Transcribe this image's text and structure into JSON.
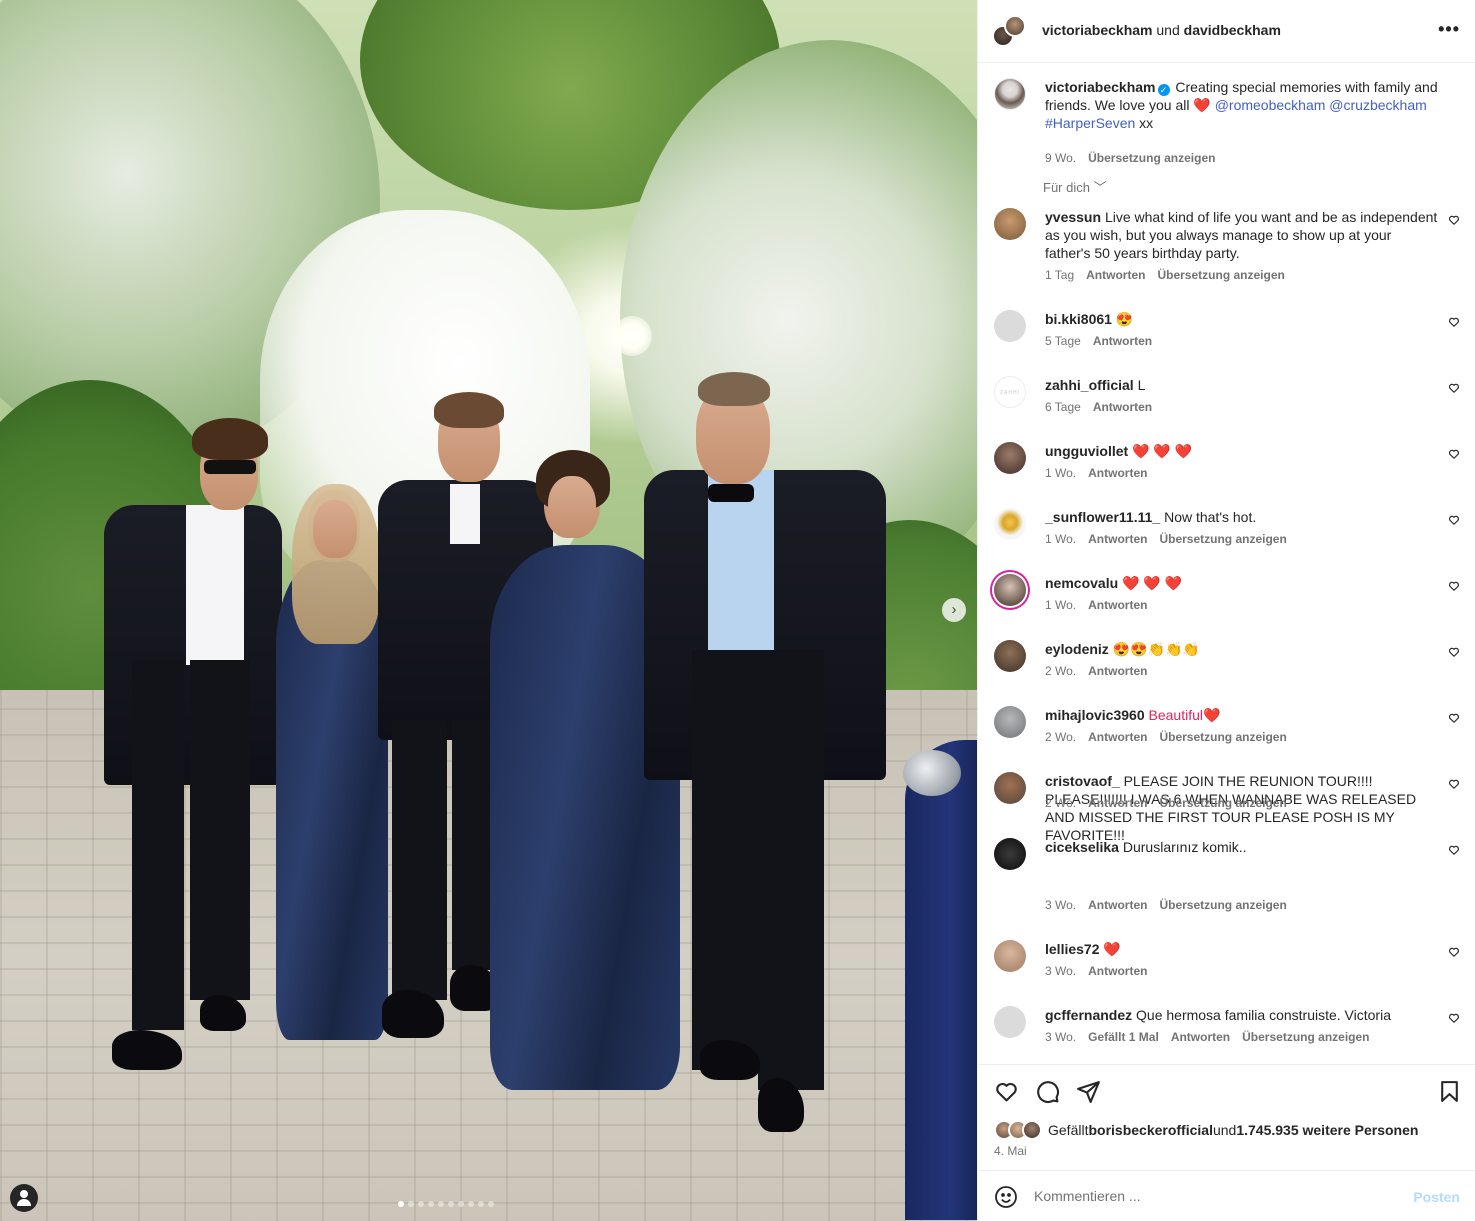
{
  "header": {
    "user1": "victoriabeckham",
    "connector": " und ",
    "user2": "davidbeckham",
    "more_icon": "more-horizontal-icon"
  },
  "caption": {
    "username": "victoriabeckham",
    "text": " Creating special memories with family and friends. We love you all ",
    "heart": "❤️",
    "mention1": "@romeobeckham",
    "mention2": "@cruzbeckham",
    "hashtag": "#HarperSeven",
    "tail": " xx",
    "time": "9 Wo.",
    "translate": "Übersetzung anzeigen"
  },
  "filter": {
    "label": "Für dich"
  },
  "comments": [
    {
      "username": "yvessun",
      "text": "Live what kind of life you want and be as independent as you wish, but you always manage to show up at your father's 50 years birthday party.",
      "time": "1 Tag",
      "reply": "Antworten",
      "translate": "Übersetzung anzeigen"
    },
    {
      "username": "bi.kki8061",
      "text": "😍",
      "time": "5 Tage",
      "reply": "Antworten"
    },
    {
      "username": "zahhi_official",
      "text": "L",
      "time": "6 Tage",
      "reply": "Antworten"
    },
    {
      "username": "ungguviollet",
      "text": "❤️ ❤️ ❤️",
      "time": "1 Wo.",
      "reply": "Antworten"
    },
    {
      "username": "_sunflower11.11_",
      "text": "Now that's hot.",
      "time": "1 Wo.",
      "reply": "Antworten",
      "translate": "Übersetzung anzeigen"
    },
    {
      "username": "nemcovalu",
      "text": "❤️ ❤️ ❤️",
      "time": "1 Wo.",
      "reply": "Antworten"
    },
    {
      "username": "eylodeniz",
      "text": "😍😍👏👏👏",
      "time": "2 Wo.",
      "reply": "Antworten"
    },
    {
      "username": "mihajlovic3960",
      "text": "Beautiful❤️",
      "time": "2 Wo.",
      "reply": "Antworten",
      "translate": "Übersetzung anzeigen"
    },
    {
      "username": "cristovaof_",
      "text": "PLEASE JOIN THE REUNION TOUR!!!! PLEASE!!!!!!! I WAS 6 WHEN WANNABE WAS RELEASED AND MISSED THE FIRST TOUR PLEASE POSH IS MY FAVORITE!!!",
      "time": "2 Wo.",
      "reply": "Antworten",
      "translate": "Übersetzung anzeigen"
    },
    {
      "username": "cicekselika",
      "text": "Duruslarınız komik..",
      "time": "3 Wo.",
      "reply": "Antworten",
      "translate": "Übersetzung anzeigen"
    },
    {
      "username": "lellies72",
      "text": "❤️",
      "time": "3 Wo.",
      "reply": "Antworten"
    },
    {
      "username": "gcffernandez",
      "text": "Que hermosa familia construiste. Victoria",
      "time": "3 Wo.",
      "likes": "Gefällt 1 Mal",
      "reply": "Antworten",
      "translate": "Übersetzung anzeigen"
    }
  ],
  "zahhi_avatar_text": "ZAHHI",
  "actions": {
    "likes_prefix": "Gefällt ",
    "likes_user": "borisbeckerofficial",
    "likes_mid": " und ",
    "likes_count": "1.745.935 weitere Personen",
    "date": "4. Mai"
  },
  "composer": {
    "placeholder": "Kommentieren ...",
    "post": "Posten"
  },
  "carousel": {
    "total_slides": 10,
    "active_slide": 1
  },
  "colors": {
    "link": "#4460c4",
    "verified": "#0095f6",
    "heart": "#e0245e",
    "post_disabled": "#b3dbff"
  }
}
